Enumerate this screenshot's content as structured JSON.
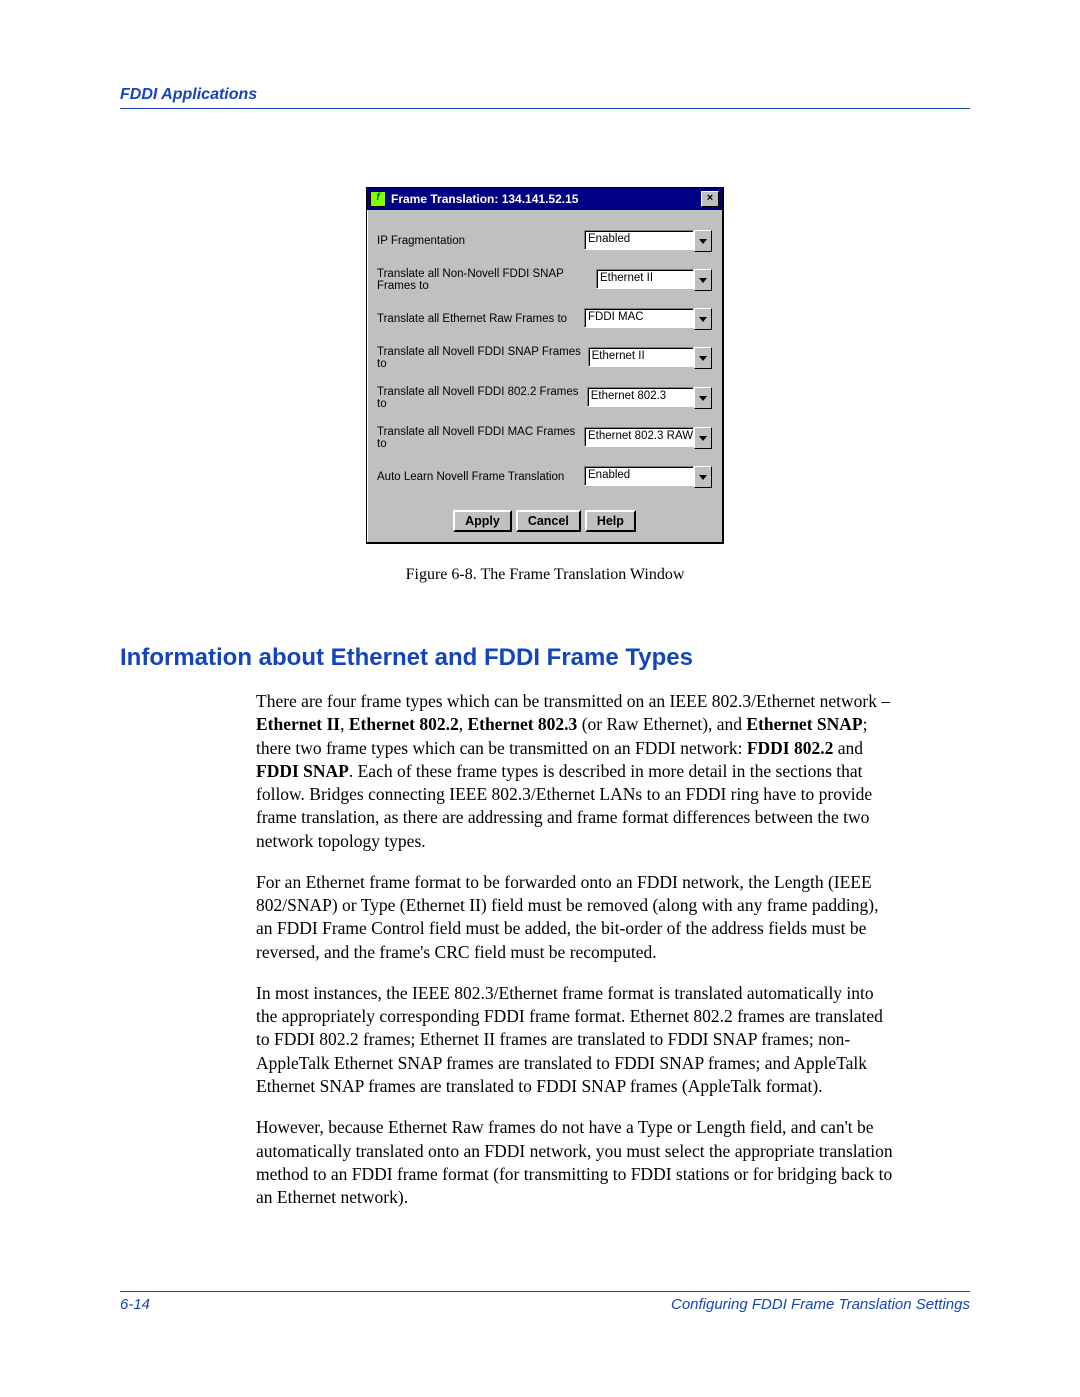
{
  "header": {
    "breadcrumb": "FDDI Applications"
  },
  "dialog": {
    "title": "Frame Translation: 134.141.52.15",
    "rows": [
      {
        "label": "IP Fragmentation",
        "value": "Enabled"
      },
      {
        "label": "Translate all Non-Novell FDDI SNAP Frames to",
        "value": "Ethernet II"
      },
      {
        "label": "Translate all Ethernet Raw Frames to",
        "value": "FDDI MAC"
      },
      {
        "label": "Translate all Novell FDDI SNAP Frames to",
        "value": "Ethernet II"
      },
      {
        "label": "Translate all Novell FDDI 802.2 Frames to",
        "value": "Ethernet 802.3"
      },
      {
        "label": "Translate all Novell FDDI MAC Frames to",
        "value": "Ethernet 802.3 RAW"
      },
      {
        "label": "Auto Learn Novell Frame Translation",
        "value": "Enabled"
      }
    ],
    "buttons": {
      "apply": "Apply",
      "cancel": "Cancel",
      "help": "Help"
    },
    "close_glyph": "×"
  },
  "figure_caption": "Figure 6-8.  The Frame Translation Window",
  "section_heading": "Information about Ethernet and FDDI Frame Types",
  "paragraphs": {
    "p1_a": "There are four frame types which can be transmitted on an IEEE 802.3/Ethernet network – ",
    "p1_bold1": "Ethernet II",
    "p1_c1": ", ",
    "p1_bold2": "Ethernet 802.2",
    "p1_c2": ", ",
    "p1_bold3": "Ethernet 802.3",
    "p1_b": " (or Raw Ethernet), and ",
    "p1_bold4": "Ethernet SNAP",
    "p1_c": "; there two frame types which can be transmitted on an FDDI network: ",
    "p1_bold5": "FDDI 802.2",
    "p1_d": " and ",
    "p1_bold6": "FDDI SNAP",
    "p1_e": ". Each of these frame types is described in more detail in the sections that follow. Bridges connecting IEEE 802.3/Ethernet LANs to an FDDI ring have to provide frame translation, as there are addressing and frame format differences between the two network topology types.",
    "p2": "For an Ethernet frame format to be forwarded onto an FDDI network, the Length (IEEE 802/SNAP) or Type (Ethernet II) field must be removed (along with any frame padding), an FDDI Frame Control field must be added, the bit-order of the address fields must be reversed, and the frame's CRC field must be recomputed.",
    "p3": "In most instances, the IEEE 802.3/Ethernet frame format is translated automatically into the appropriately corresponding FDDI frame format. Ethernet 802.2 frames are translated to FDDI 802.2 frames; Ethernet II frames are translated to FDDI SNAP frames; non-AppleTalk Ethernet SNAP frames are translated to FDDI SNAP frames; and AppleTalk Ethernet SNAP frames are translated to FDDI SNAP frames (AppleTalk format).",
    "p4": "However, because Ethernet Raw frames do not have a Type or Length field, and can't be automatically translated onto an FDDI network, you must select the appropriate translation method to an FDDI frame format (for transmitting to FDDI stations or for bridging back to an Ethernet network)."
  },
  "footer": {
    "page": "6-14",
    "section": "Configuring FDDI Frame Translation Settings"
  }
}
